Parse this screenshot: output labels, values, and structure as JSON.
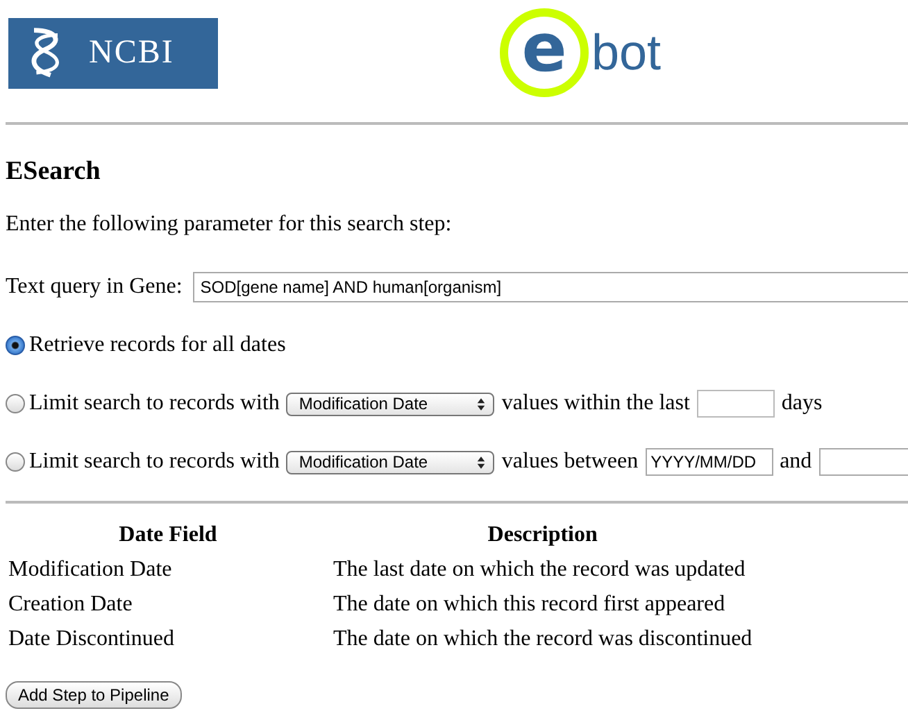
{
  "header": {
    "ncbi_logo": "NCBI",
    "ebot_mark": "e",
    "ebot_word": "bot"
  },
  "title": "ESearch",
  "intro": "Enter the following parameter for this search step:",
  "query": {
    "label": "Text query in Gene:",
    "value": "SOD[gene name] AND human[organism]"
  },
  "date_options": [
    {
      "kind": "all",
      "selected": true,
      "label": "Retrieve records for all dates"
    },
    {
      "kind": "within",
      "selected": false,
      "label": "Limit search to records with",
      "select": "Modification Date",
      "middle": "values within the last",
      "unit": "days"
    },
    {
      "kind": "between",
      "selected": false,
      "label": "Limit search to records with",
      "select": "Modification Date",
      "middle": "values between",
      "from": "YYYY/MM/DD",
      "conjunction": "and"
    }
  ],
  "table": {
    "columns": [
      "Date Field",
      "Description"
    ],
    "rows": [
      [
        "Modification Date",
        "The last date on which the record was updated"
      ],
      [
        "Creation Date",
        "The date on which this record first appeared"
      ],
      [
        "Date Discontinued",
        "The date on which the record was discontinued"
      ]
    ]
  },
  "button": "Add Step to Pipeline"
}
